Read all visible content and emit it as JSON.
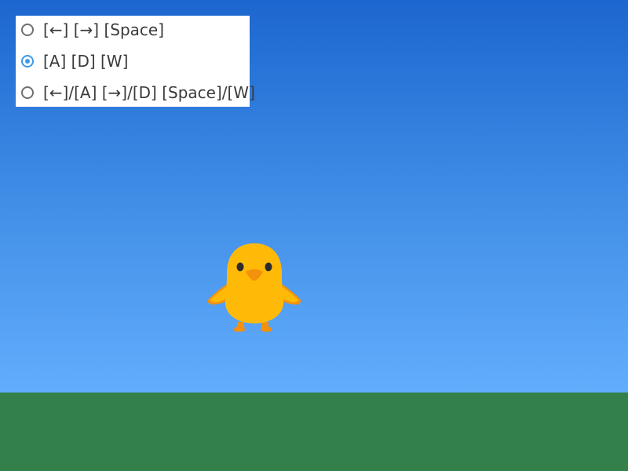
{
  "scene": {
    "sky_top_color": "#1c66cf",
    "sky_bottom_color": "#63adfd",
    "ground_color": "#34804a"
  },
  "control_scheme": {
    "selected_index": 1,
    "options": [
      {
        "label": "[←] [→] [Space]"
      },
      {
        "label": "[A] [D] [W]"
      },
      {
        "label": "[←]/[A] [→]/[D] [Space]/[W]"
      }
    ]
  },
  "player": {
    "character": "chick",
    "body_color": "#ffba08",
    "accent_color": "#f4910c"
  }
}
